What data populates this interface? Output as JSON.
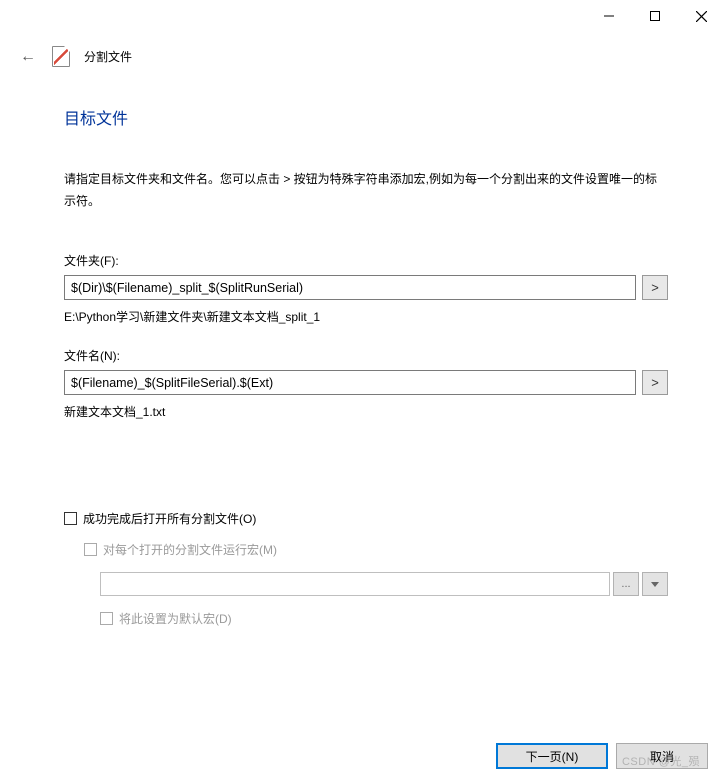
{
  "window": {
    "title": "分割文件"
  },
  "page": {
    "heading": "目标文件",
    "instructions": "请指定目标文件夹和文件名。您可以点击 > 按钮为特殊字符串添加宏,例如为每一个分割出来的文件设置唯一的标示符。"
  },
  "folder": {
    "label": "文件夹(F):",
    "value": "$(Dir)\\$(Filename)_split_$(SplitRunSerial)",
    "macro_btn": ">",
    "preview": "E:\\Python学习\\新建文件夹\\新建文本文档_split_1"
  },
  "filename": {
    "label": "文件名(N):",
    "value": "$(Filename)_$(SplitFileSerial).$(Ext)",
    "macro_btn": ">",
    "preview": "新建文本文档_1.txt"
  },
  "options": {
    "open_after": "成功完成后打开所有分割文件(O)",
    "run_macro": "对每个打开的分割文件运行宏(M)",
    "browse_btn": "...",
    "dropdown_btn": "▾",
    "set_default": "将此设置为默认宏(D)"
  },
  "footer": {
    "next": "下一页(N)",
    "cancel": "取消"
  },
  "watermark": "CSDN @光_殒"
}
